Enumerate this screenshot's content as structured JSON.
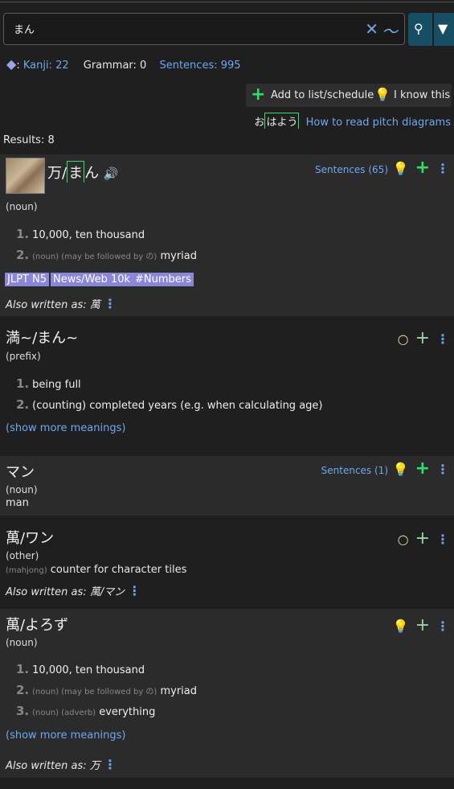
{
  "search": {
    "value": "まん",
    "clear_icon": "✕",
    "handwriting_icon": "〜"
  },
  "stats": {
    "kanji": "Kanji: 22",
    "grammar": "Grammar: 0",
    "sentences": "Sentences: 995"
  },
  "actions": {
    "add_to_list": "Add to list/schedule",
    "i_know": "I know this"
  },
  "pitch": {
    "example_o": "お",
    "example_rest": "はよう",
    "help_link": "How to read pitch diagrams"
  },
  "results_label": "Results: 8",
  "entries": [
    {
      "word_a": "万/",
      "word_b": "ま",
      "word_c": "ん",
      "sentences": "Sentences (65)",
      "pos": "(noun)",
      "m1": "10,000, ten thousand",
      "m2_note": "(noun) (may be followed by の)",
      "m2": "myriad",
      "tags": [
        "JLPT N5",
        "News/Web 10k",
        "#Numbers"
      ],
      "also_label": "Also written as:",
      "also": "萬"
    },
    {
      "word": "満~/まん~",
      "pos": "(prefix)",
      "m1": "being full",
      "m2": "(counting) completed years (e.g. when calculating age)",
      "show_more": "(show more meanings)"
    },
    {
      "word": "マン",
      "sentences": "Sentences (1)",
      "pos": "(noun)",
      "m1": "man"
    },
    {
      "word": "萬/ワン",
      "pos": "(other)",
      "m1_note": "(mahjong)",
      "m1": "counter for character tiles",
      "also_label": "Also written as:",
      "also": "萬/マン"
    },
    {
      "word": "萬/よろず",
      "pos": "(noun)",
      "m1": "10,000, ten thousand",
      "m2_note": "(noun) (may be followed by の)",
      "m2": "myriad",
      "m3_note": "(noun) (adverb)",
      "m3": "everything",
      "show_more": "(show more meanings)",
      "also_label": "Also written as:",
      "also": "万"
    }
  ],
  "icons": {
    "bulb": "bulb-icon",
    "plus": "plus-icon",
    "kebab": "kebab-icon",
    "audio": "audio-icon"
  },
  "colors": {
    "accent": "#6ea8f0",
    "plus": "#2ee06a",
    "bulb": "#f4c430",
    "tag": "#8b86d8",
    "button": "#164e63"
  }
}
